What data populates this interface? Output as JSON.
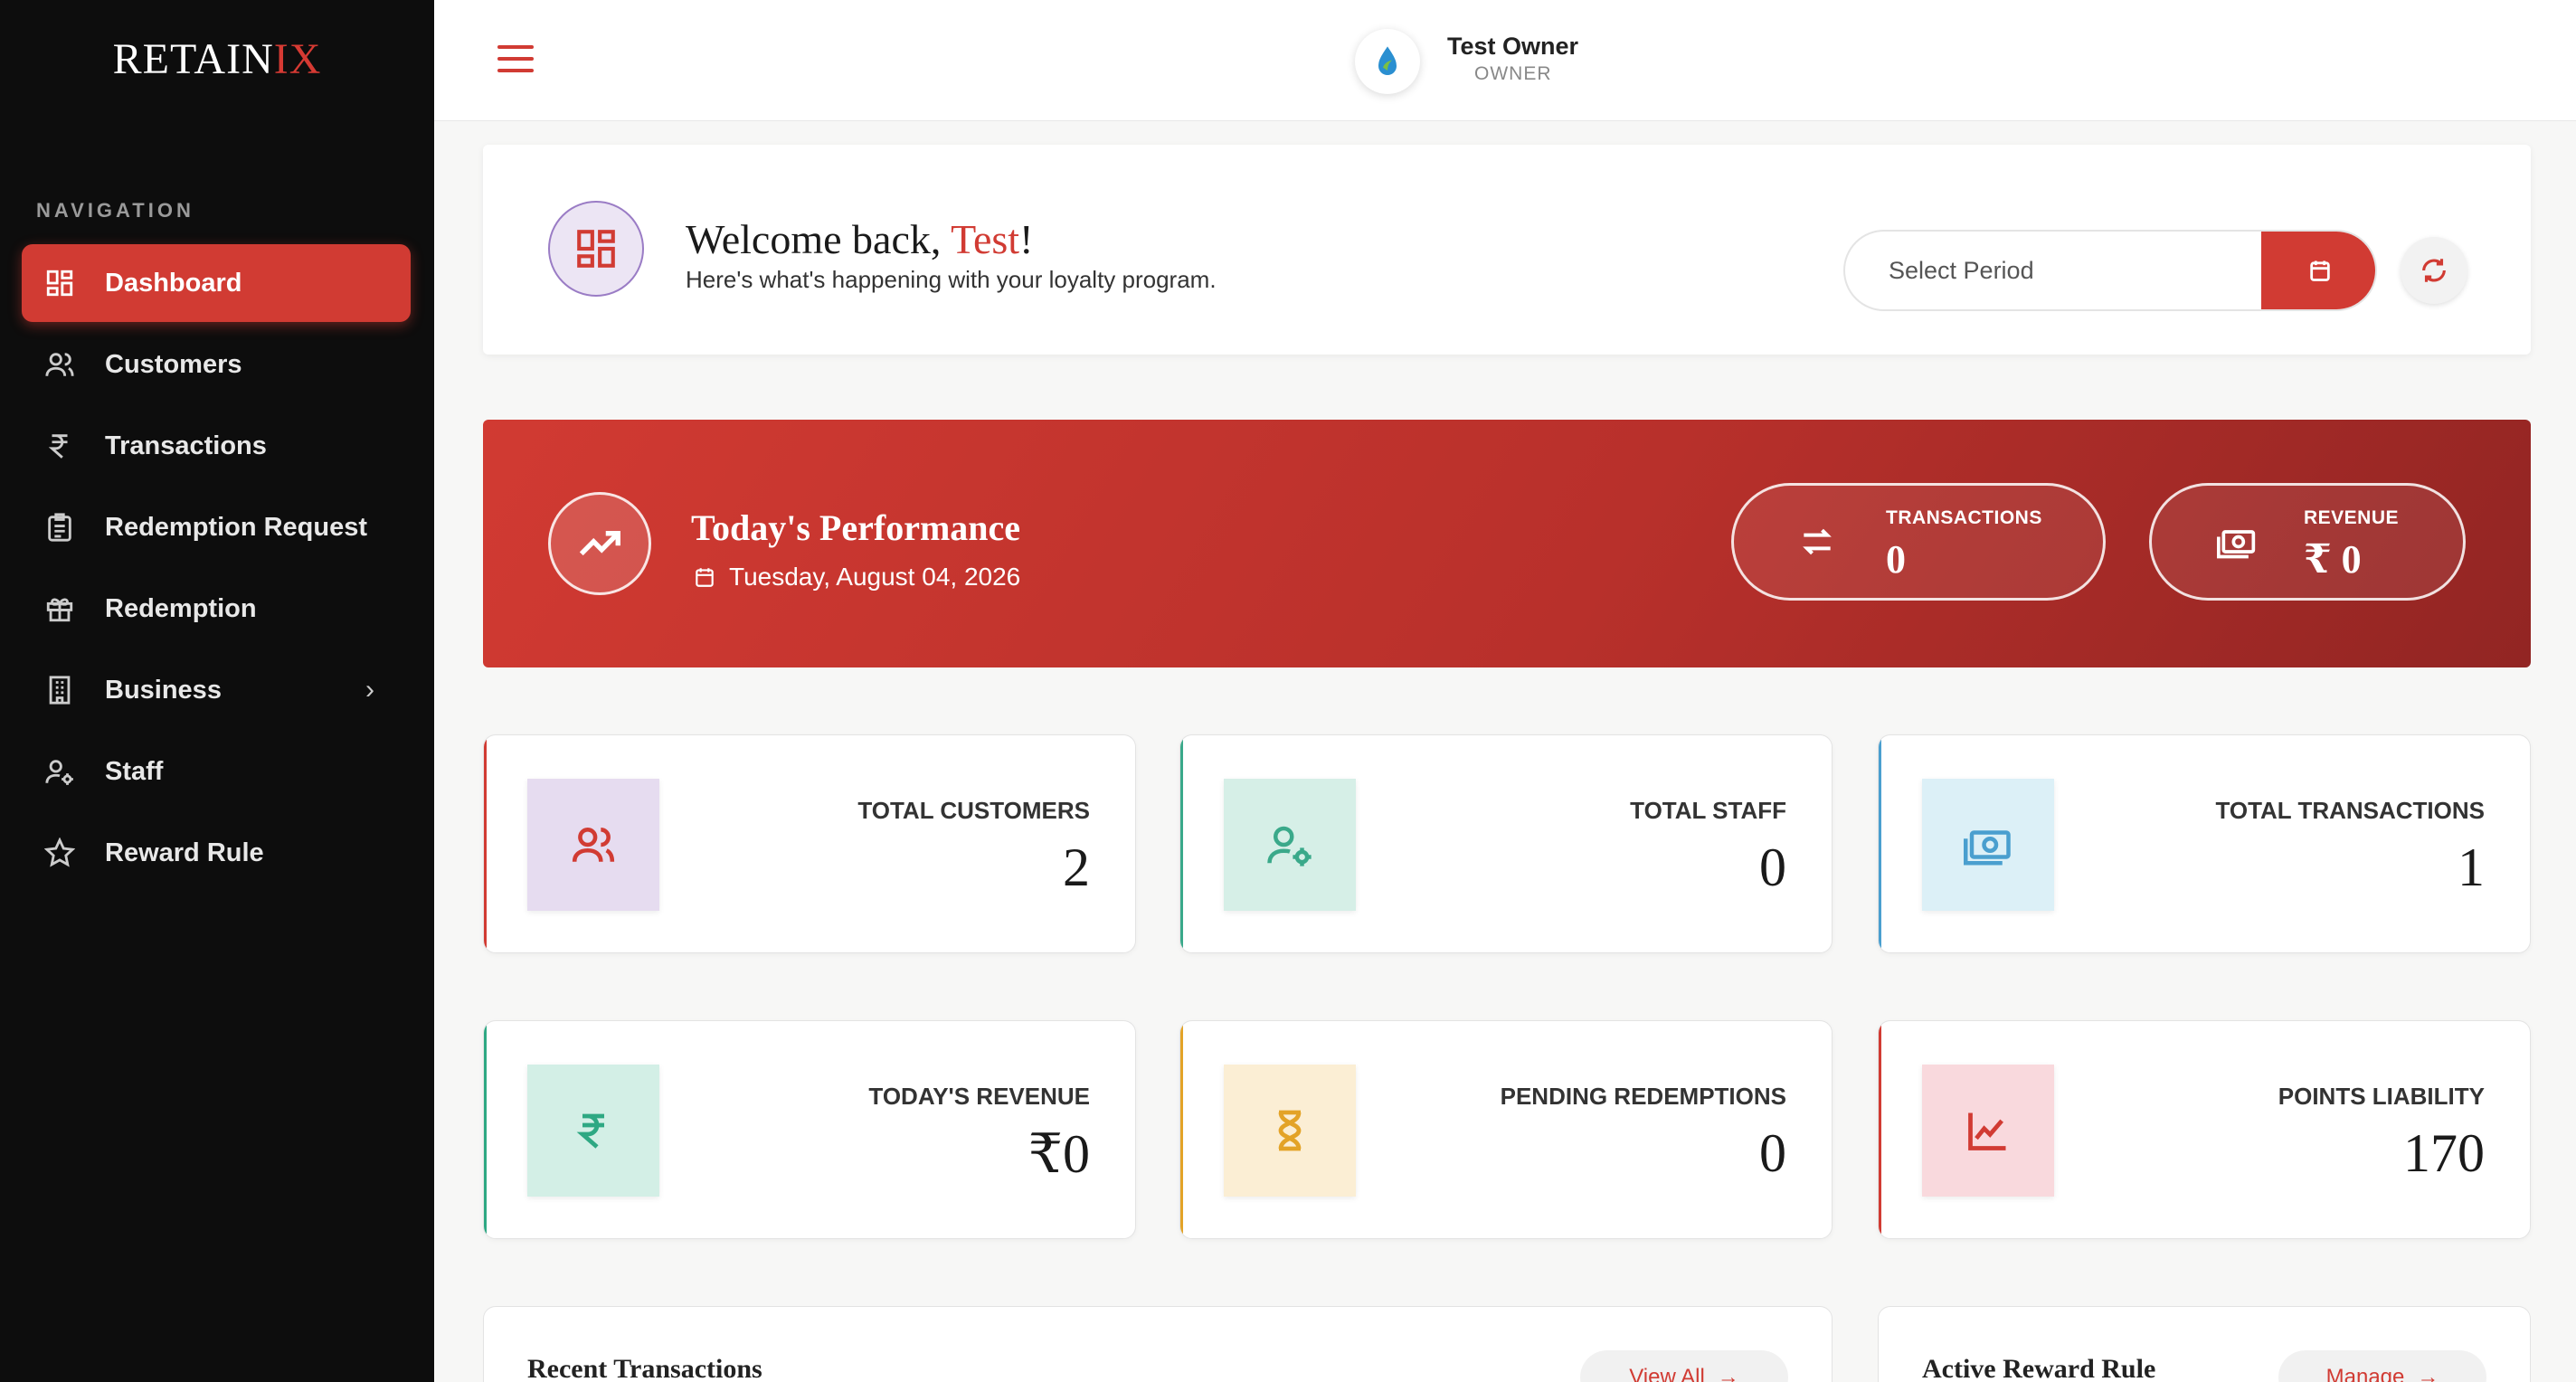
{
  "brand": {
    "name_main": "RETAIN",
    "name_accent": "IX"
  },
  "sidebar": {
    "heading": "NAVIGATION",
    "items": [
      {
        "label": "Dashboard",
        "icon": "dashboard-icon",
        "active": true
      },
      {
        "label": "Customers",
        "icon": "users-icon"
      },
      {
        "label": "Transactions",
        "icon": "rupee-icon"
      },
      {
        "label": "Redemption Request",
        "icon": "clipboard-icon"
      },
      {
        "label": "Redemption",
        "icon": "gift-icon"
      },
      {
        "label": "Business",
        "icon": "building-icon",
        "has_children": true
      },
      {
        "label": "Staff",
        "icon": "user-gear-icon"
      },
      {
        "label": "Reward Rule",
        "icon": "star-icon"
      }
    ]
  },
  "topbar": {
    "user_name": "Test Owner",
    "user_role": "OWNER"
  },
  "welcome": {
    "title_prefix": "Welcome back, ",
    "name": "Test",
    "title_suffix": "!",
    "subtitle": "Here's what's happening with your loyalty program.",
    "period_placeholder": "Select Period"
  },
  "performance": {
    "title": "Today's Performance",
    "date": "Tuesday, August 04, 2026",
    "transactions_label": "TRANSACTIONS",
    "transactions_value": "0",
    "revenue_label": "REVENUE",
    "revenue_value": "₹ 0"
  },
  "stats": [
    {
      "label": "TOTAL CUSTOMERS",
      "value": "2",
      "icon": "users-icon",
      "color": "#d13b33",
      "bg": "#e6dcf0"
    },
    {
      "label": "TOTAL STAFF",
      "value": "0",
      "icon": "user-gear-icon",
      "color": "#3aa98a",
      "bg": "#d6efe7"
    },
    {
      "label": "TOTAL TRANSACTIONS",
      "value": "1",
      "icon": "cash-icon",
      "color": "#4a9fcf",
      "bg": "#dcf0f7"
    },
    {
      "label": "TODAY'S REVENUE",
      "value": "₹0",
      "icon": "rupee-icon",
      "color": "#2ea883",
      "bg": "#d3efe6"
    },
    {
      "label": "PENDING REDEMPTIONS",
      "value": "0",
      "icon": "hourglass-icon",
      "color": "#e3a327",
      "bg": "#fbeed4"
    },
    {
      "label": "POINTS LIABILITY",
      "value": "170",
      "icon": "chart-line-icon",
      "color": "#d13b33",
      "bg": "#f9d9dd"
    }
  ],
  "panels": {
    "recent_title": "Recent Transactions",
    "recent_button": "View All",
    "reward_title": "Active Reward Rule",
    "reward_button": "Manage"
  },
  "colors": {
    "accent": "#d13b33",
    "sidebar_bg": "#0d0d0d"
  }
}
